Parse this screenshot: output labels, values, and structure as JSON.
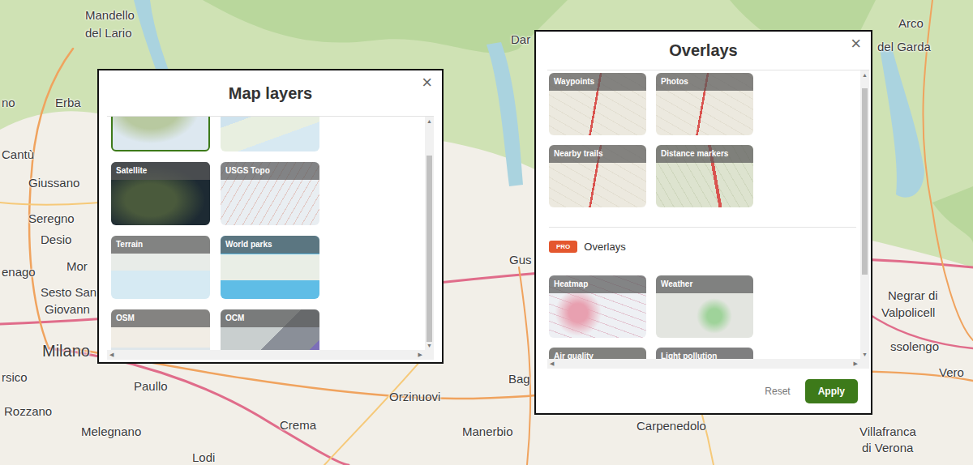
{
  "map": {
    "labels": [
      "Mandello",
      "del Lario",
      "Arco",
      "del Garda",
      "no",
      "Erba",
      "Cantù",
      "Giussano",
      "Seregno",
      "Desio",
      "enago",
      "Mor",
      "Sesto San",
      "Giovann",
      "Milano",
      "rsico",
      "Paullo",
      "Rozzano",
      "Melegnano",
      "Lodi",
      "Crema",
      "Orzinuovi",
      "Manerbio",
      "Bag",
      "Gus",
      "Dar",
      "Carpenedolo",
      "Negrar di",
      "Valpolicell",
      "ssolengo",
      "Vero",
      "Villafranca",
      "di Verona"
    ]
  },
  "map_layers": {
    "title": "Map layers",
    "close": "×",
    "layers": [
      {
        "label": "",
        "selected": true
      },
      {
        "label": "",
        "selected": false
      },
      {
        "label": "Satellite",
        "selected": false
      },
      {
        "label": "USGS Topo",
        "selected": false
      },
      {
        "label": "Terrain",
        "selected": false
      },
      {
        "label": "World parks",
        "selected": false
      },
      {
        "label": "OSM",
        "selected": false
      },
      {
        "label": "OCM",
        "selected": false
      }
    ]
  },
  "overlays": {
    "title": "Overlays",
    "close": "×",
    "items": [
      {
        "label": "Waypoints",
        "selected": false
      },
      {
        "label": "Photos",
        "selected": false
      },
      {
        "label": "Nearby trails",
        "selected": false
      },
      {
        "label": "Distance markers",
        "selected": false
      }
    ],
    "pro": {
      "badge": "PRO",
      "title": "Overlays",
      "items": [
        {
          "label": "Heatmap",
          "selected": false
        },
        {
          "label": "Weather",
          "selected": false
        },
        {
          "label": "Air quality",
          "selected": false
        },
        {
          "label": "Light pollution",
          "selected": false
        }
      ]
    },
    "buttons": {
      "reset": "Reset",
      "apply": "Apply"
    }
  }
}
